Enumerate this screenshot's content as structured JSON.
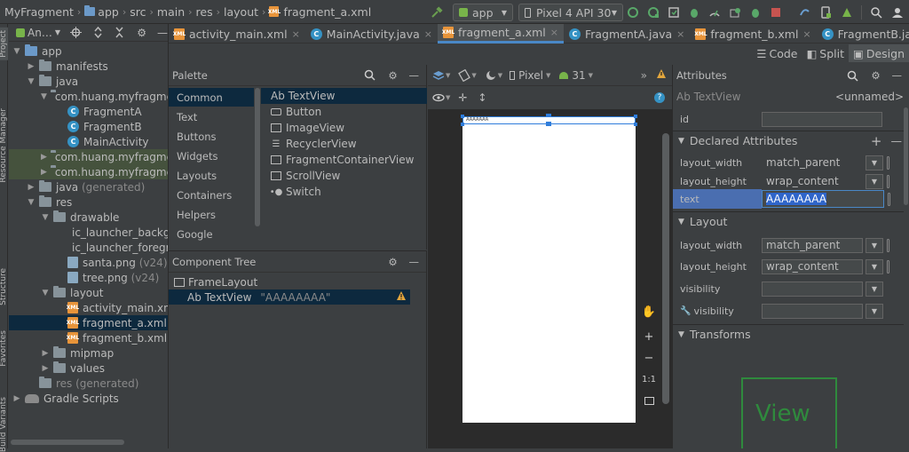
{
  "navbar": {
    "breadcrumbs": [
      "MyFragment",
      "app",
      "src",
      "main",
      "res",
      "layout",
      "fragment_a.xml"
    ],
    "run_config": "app",
    "device": "Pixel 4 API 30"
  },
  "project": {
    "header_label": "An…",
    "items": [
      {
        "label": "app",
        "indent": 0
      },
      {
        "label": "manifests",
        "indent": 1
      },
      {
        "label": "java",
        "indent": 1
      },
      {
        "label": "com.huang.myfragme",
        "indent": 2
      },
      {
        "label": "FragmentA",
        "indent": 3
      },
      {
        "label": "FragmentB",
        "indent": 3
      },
      {
        "label": "MainActivity",
        "indent": 3
      },
      {
        "label": "com.huang.myfragme",
        "indent": 2
      },
      {
        "label": "com.huang.myfragme",
        "indent": 2
      },
      {
        "label": "java",
        "suffix": "(generated)",
        "indent": 1
      },
      {
        "label": "res",
        "indent": 1
      },
      {
        "label": "drawable",
        "indent": 2
      },
      {
        "label": "ic_launcher_backg",
        "indent": 3
      },
      {
        "label": "ic_launcher_foregr",
        "indent": 3
      },
      {
        "label": "santa.png",
        "suffix": "(v24)",
        "indent": 3
      },
      {
        "label": "tree.png",
        "suffix": "(v24)",
        "indent": 3
      },
      {
        "label": "layout",
        "indent": 2
      },
      {
        "label": "activity_main.xml",
        "indent": 3
      },
      {
        "label": "fragment_a.xml",
        "indent": 3
      },
      {
        "label": "fragment_b.xml",
        "indent": 3
      },
      {
        "label": "mipmap",
        "indent": 2
      },
      {
        "label": "values",
        "indent": 2
      },
      {
        "label": "res (generated)",
        "indent": 1
      },
      {
        "label": "Gradle Scripts",
        "indent": 0
      }
    ]
  },
  "side_labels": {
    "project": "Project",
    "resource_manager": "Resource Manager",
    "structure": "Structure",
    "favorites": "Favorites",
    "build_variants": "Build Variants"
  },
  "tabs": [
    {
      "label": "activity_main.xml"
    },
    {
      "label": "MainActivity.java"
    },
    {
      "label": "fragment_a.xml"
    },
    {
      "label": "FragmentA.java"
    },
    {
      "label": "fragment_b.xml"
    },
    {
      "label": "FragmentB.java"
    }
  ],
  "view_modes": {
    "code": "Code",
    "split": "Split",
    "design": "Design"
  },
  "palette": {
    "title": "Palette",
    "categories": [
      "Common",
      "Text",
      "Buttons",
      "Widgets",
      "Layouts",
      "Containers",
      "Helpers",
      "Google"
    ],
    "items": [
      "Ab TextView",
      "Button",
      "ImageView",
      "RecyclerView",
      "FragmentContainerView",
      "ScrollView",
      "Switch"
    ]
  },
  "component_tree": {
    "title": "Component Tree",
    "root": "FrameLayout",
    "child_label": "Ab TextView",
    "child_text": "\"AAAAAAAA\""
  },
  "canvas": {
    "device": "Pixel",
    "api": "31",
    "preview_text": "AAAAAAA",
    "zoom_ratio": "1:1"
  },
  "attributes": {
    "title": "Attributes",
    "widget": "Ab TextView",
    "unnamed": "<unnamed>",
    "id_label": "id",
    "id_value": "",
    "declared_title": "Declared Attributes",
    "declared": [
      {
        "name": "layout_width",
        "value": "match_parent"
      },
      {
        "name": "layout_height",
        "value": "wrap_content"
      },
      {
        "name": "text",
        "value": "AAAAAAAA"
      }
    ],
    "layout_title": "Layout",
    "layout": [
      {
        "name": "layout_width",
        "value": "match_parent"
      },
      {
        "name": "layout_height",
        "value": "wrap_content"
      },
      {
        "name": "visibility",
        "value": ""
      },
      {
        "name": "visibility",
        "value": ""
      }
    ],
    "transforms_title": "Transforms",
    "view_preview": "View"
  }
}
